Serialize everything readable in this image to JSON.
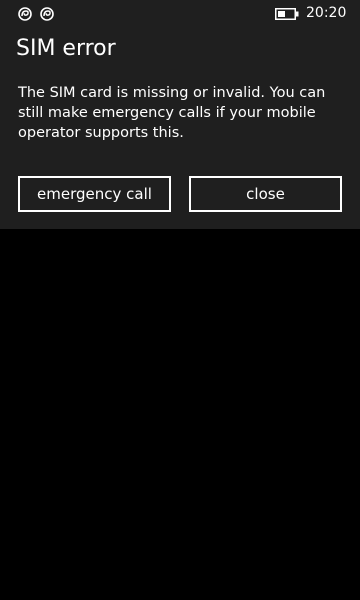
{
  "status_bar": {
    "time": "20:20",
    "icons": [
      "notification-swirl-icon",
      "notification-swirl-icon",
      "battery-icon"
    ]
  },
  "dialog": {
    "title": "SIM error",
    "message": "The SIM card is missing or invalid. You can still make emergency calls if your mobile operator supports this.",
    "buttons": {
      "emergency_label": "emergency call",
      "close_label": "close"
    }
  },
  "colors": {
    "dialog_background": "#1f1f1f",
    "screen_background": "#000000",
    "text": "#ffffff"
  }
}
